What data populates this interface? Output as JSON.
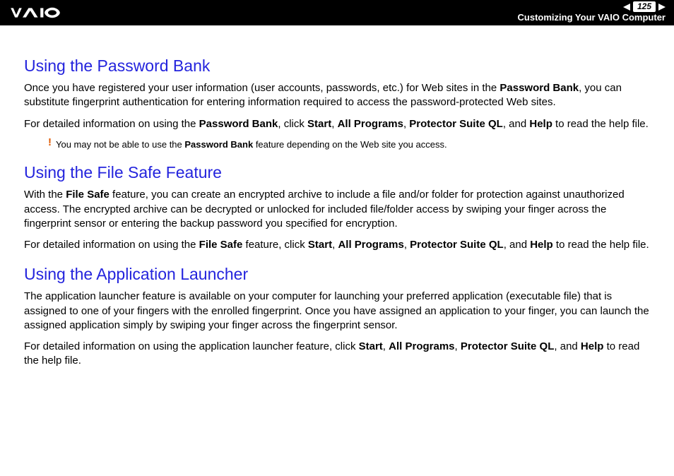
{
  "header": {
    "page_number": "125",
    "breadcrumb": "Customizing Your VAIO Computer"
  },
  "sections": {
    "s1": {
      "title": "Using the Password Bank",
      "p1a": "Once you have registered your user information (user accounts, passwords, etc.) for Web sites in the ",
      "p1b": "Password Bank",
      "p1c": ", you can substitute fingerprint authentication for entering information required to access the password-protected Web sites.",
      "p2a": "For detailed information on using the ",
      "p2b": "Password Bank",
      "p2c": ", click ",
      "p2d": "Start",
      "p2e": ", ",
      "p2f": "All Programs",
      "p2g": ", ",
      "p2h": "Protector Suite QL",
      "p2i": ", and ",
      "p2j": "Help",
      "p2k": " to read the help file.",
      "note_a": "You may not be able to use the ",
      "note_b": "Password Bank",
      "note_c": " feature depending on the Web site you access."
    },
    "s2": {
      "title": "Using the File Safe Feature",
      "p1a": "With the ",
      "p1b": "File Safe",
      "p1c": " feature, you can create an encrypted archive to include a file and/or folder for protection against unauthorized access. The encrypted archive can be decrypted or unlocked for included file/folder access by swiping your finger across the fingerprint sensor or entering the backup password you specified for encryption.",
      "p2a": "For detailed information on using the ",
      "p2b": "File Safe",
      "p2c": " feature, click ",
      "p2d": "Start",
      "p2e": ", ",
      "p2f": "All Programs",
      "p2g": ", ",
      "p2h": "Protector Suite QL",
      "p2i": ", and ",
      "p2j": "Help",
      "p2k": " to read the help file."
    },
    "s3": {
      "title": "Using the Application Launcher",
      "p1": "The application launcher feature is available on your computer for launching your preferred application (executable file) that is assigned to one of your fingers with the enrolled fingerprint. Once you have assigned an application to your finger, you can launch the assigned application simply by swiping your finger across the fingerprint sensor.",
      "p2a": "For detailed information on using the application launcher feature, click ",
      "p2b": "Start",
      "p2c": ", ",
      "p2d": "All Programs",
      "p2e": ", ",
      "p2f": "Protector Suite QL",
      "p2g": ", and ",
      "p2h": "Help",
      "p2i": " to read the help file."
    }
  }
}
